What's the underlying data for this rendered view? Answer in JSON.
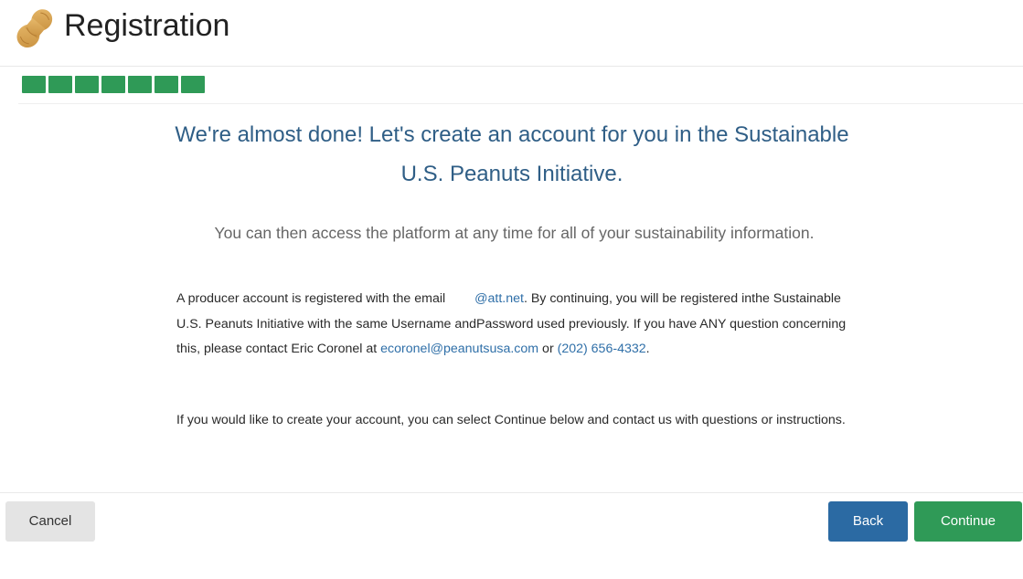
{
  "header": {
    "title": "Registration"
  },
  "progress": {
    "completed_steps": 7,
    "total_steps": 7,
    "color": "#2f9a57"
  },
  "main": {
    "heading": "We're almost done! Let's create an account for you in the Sustainable U.S. Peanuts Initiative.",
    "subheading": "You can then access the platform at any time for all of your sustainability information.",
    "paragraph1": {
      "before_email": "A producer account is registered with the email ",
      "email": "@att.net",
      "after_email": ". By continuing, you will be registered inthe Sustainable U.S. Peanuts Initiative with the same Username andPassword used previously. If you have ANY question concerning this, please contact Eric Coronel at ",
      "contact_email": "ecoronel@peanutsusa.com",
      "or_text": " or ",
      "contact_phone": "(202) 656-4332",
      "end": "."
    },
    "paragraph2": "If you would like to create your account, you can select Continue below and contact us with questions or instructions."
  },
  "footer": {
    "cancel_label": "Cancel",
    "back_label": "Back",
    "continue_label": "Continue"
  },
  "colors": {
    "heading": "#2f5e86",
    "link": "#2f6fa8",
    "back_button": "#2b6aa3",
    "continue_button": "#2f9a57",
    "cancel_button": "#e4e4e4"
  },
  "icons": {
    "logo": "peanut-icon"
  }
}
